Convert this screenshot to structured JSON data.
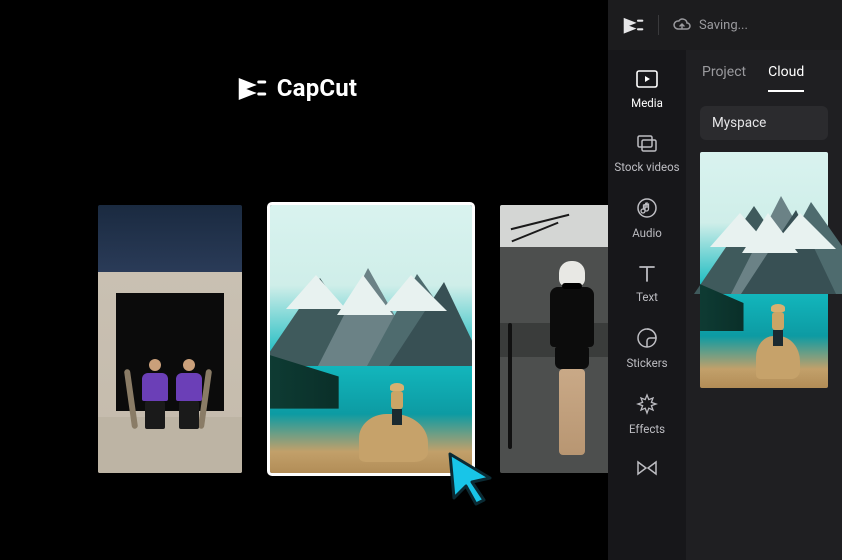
{
  "brand": {
    "name": "CapCut"
  },
  "gallery": {
    "items": [
      {
        "selected": false
      },
      {
        "selected": true
      },
      {
        "selected": false
      }
    ]
  },
  "editor": {
    "status": "Saving...",
    "sidenav": [
      {
        "label": "Media",
        "icon": "media",
        "active": true
      },
      {
        "label": "Stock videos",
        "icon": "stock",
        "active": false
      },
      {
        "label": "Audio",
        "icon": "audio",
        "active": false
      },
      {
        "label": "Text",
        "icon": "text",
        "active": false
      },
      {
        "label": "Stickers",
        "icon": "stickers",
        "active": false
      },
      {
        "label": "Effects",
        "icon": "effects",
        "active": false
      }
    ],
    "tabs": [
      {
        "label": "Project",
        "active": false
      },
      {
        "label": "Cloud",
        "active": true
      }
    ],
    "space": "Myspace"
  }
}
